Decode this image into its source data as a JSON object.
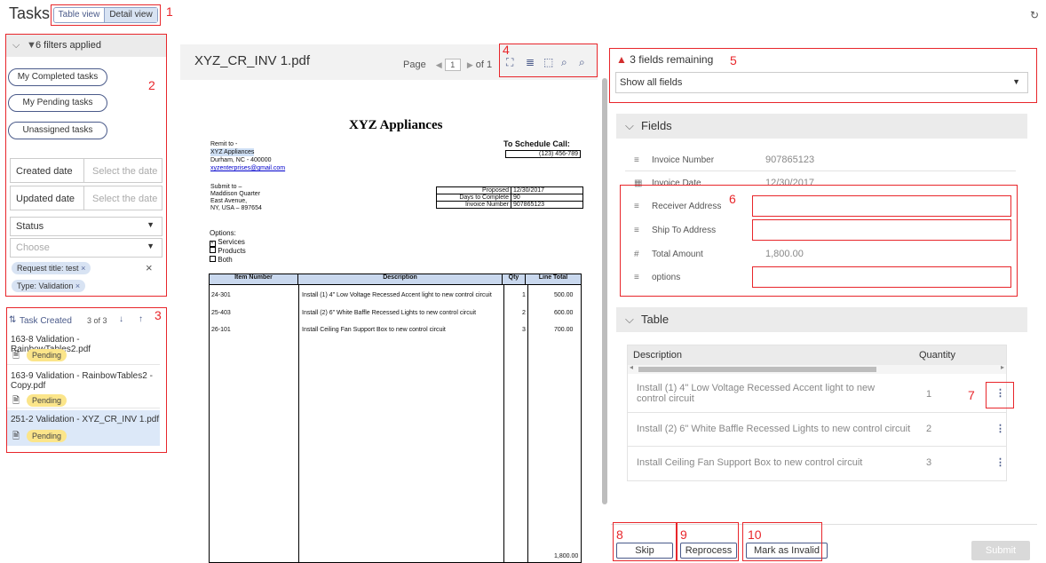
{
  "header": {
    "title": "Tasks",
    "table_view": "Table view",
    "detail_view": "Detail view",
    "refresh_icon": "refresh-icon"
  },
  "annotations": [
    "1",
    "2",
    "3",
    "4",
    "5",
    "6",
    "7",
    "8",
    "9",
    "10"
  ],
  "filters": {
    "summary": "6 filters applied",
    "my_completed": "My Completed tasks",
    "my_pending": "My Pending tasks",
    "unassigned": "Unassigned tasks",
    "created_label": "Created date",
    "created_placeholder": "Select the date",
    "updated_label": "Updated date",
    "updated_placeholder": "Select the date",
    "status_label": "Status",
    "choose_placeholder": "Choose",
    "chips": [
      "Request title: test",
      "Type: Validation"
    ]
  },
  "task_list": {
    "sort_label": "Task Created",
    "count": "3 of 3",
    "items": [
      {
        "title": "163-8 Validation - RainbowTables2.pdf",
        "status": "Pending"
      },
      {
        "title": "163-9 Validation - RainbowTables2 - Copy.pdf",
        "status": "Pending"
      },
      {
        "title": "251-2 Validation - XYZ_CR_INV 1.pdf",
        "status": "Pending"
      }
    ]
  },
  "viewer": {
    "filename": "XYZ_CR_INV 1.pdf",
    "page_label": "Page",
    "page_value": "1",
    "of_label": "of 1"
  },
  "document": {
    "company": "XYZ Appliances",
    "remit_lines": [
      "Remit to -",
      "XYZ Appliances",
      "Durham, NC - 400000",
      "xyzenterprises@gmail.com"
    ],
    "schedule_title": "To Schedule Call:",
    "schedule_phone": "(123) 456-789",
    "submit_lines": [
      "Submit to –",
      "Maddison Quarter",
      "East Avenue,",
      "NY, USA – 897654"
    ],
    "proposed_label": "Proposed",
    "proposed_value": "12/30/2017",
    "days_label": "Days to Complete",
    "days_value": "90",
    "invoice_label": "Invoice Number",
    "invoice_value": "907865123",
    "options_label": "Options:",
    "option_services": "Services",
    "option_products": "Products",
    "option_both": "Both",
    "table_headers": [
      "Item Number",
      "Description",
      "Qty",
      "Line Total"
    ],
    "rows": [
      {
        "item": "24-301",
        "desc": "Install (1) 4\" Low Voltage Recessed Accent light to new control circuit",
        "qty": "1",
        "total": "500.00"
      },
      {
        "item": "25-403",
        "desc": "Install (2) 6\" White Baffle Recessed Lights to new control circuit",
        "qty": "2",
        "total": "600.00"
      },
      {
        "item": "26-101",
        "desc": "Install Ceiling Fan Support Box to new control circuit",
        "qty": "3",
        "total": "700.00"
      }
    ],
    "grand_total": "1,800.00"
  },
  "right_panel": {
    "remaining": "3 fields remaining",
    "show_all": "Show all fields",
    "fields_title": "Fields",
    "fields": [
      {
        "label": "Invoice Number",
        "value": "907865123"
      },
      {
        "label": "Invoice Date",
        "value": "12/30/2017"
      },
      {
        "label": "Receiver Address",
        "value": ""
      },
      {
        "label": "Ship To Address",
        "value": ""
      },
      {
        "label": "Total Amount",
        "value": "1,800.00"
      },
      {
        "label": "options",
        "value": ""
      }
    ],
    "table_title": "Table",
    "table_headers": [
      "Description",
      "Quantity"
    ],
    "table_rows": [
      {
        "desc": "Install (1) 4\" Low Voltage Recessed Accent light to new control circuit",
        "qty": "1"
      },
      {
        "desc": "Install (2) 6\" White Baffle Recessed Lights to new control circuit",
        "qty": "2"
      },
      {
        "desc": "Install Ceiling Fan Support Box to new control circuit",
        "qty": "3"
      }
    ]
  },
  "actions": {
    "skip": "Skip",
    "reprocess": "Reprocess",
    "mark_invalid": "Mark as Invalid",
    "submit": "Submit"
  }
}
